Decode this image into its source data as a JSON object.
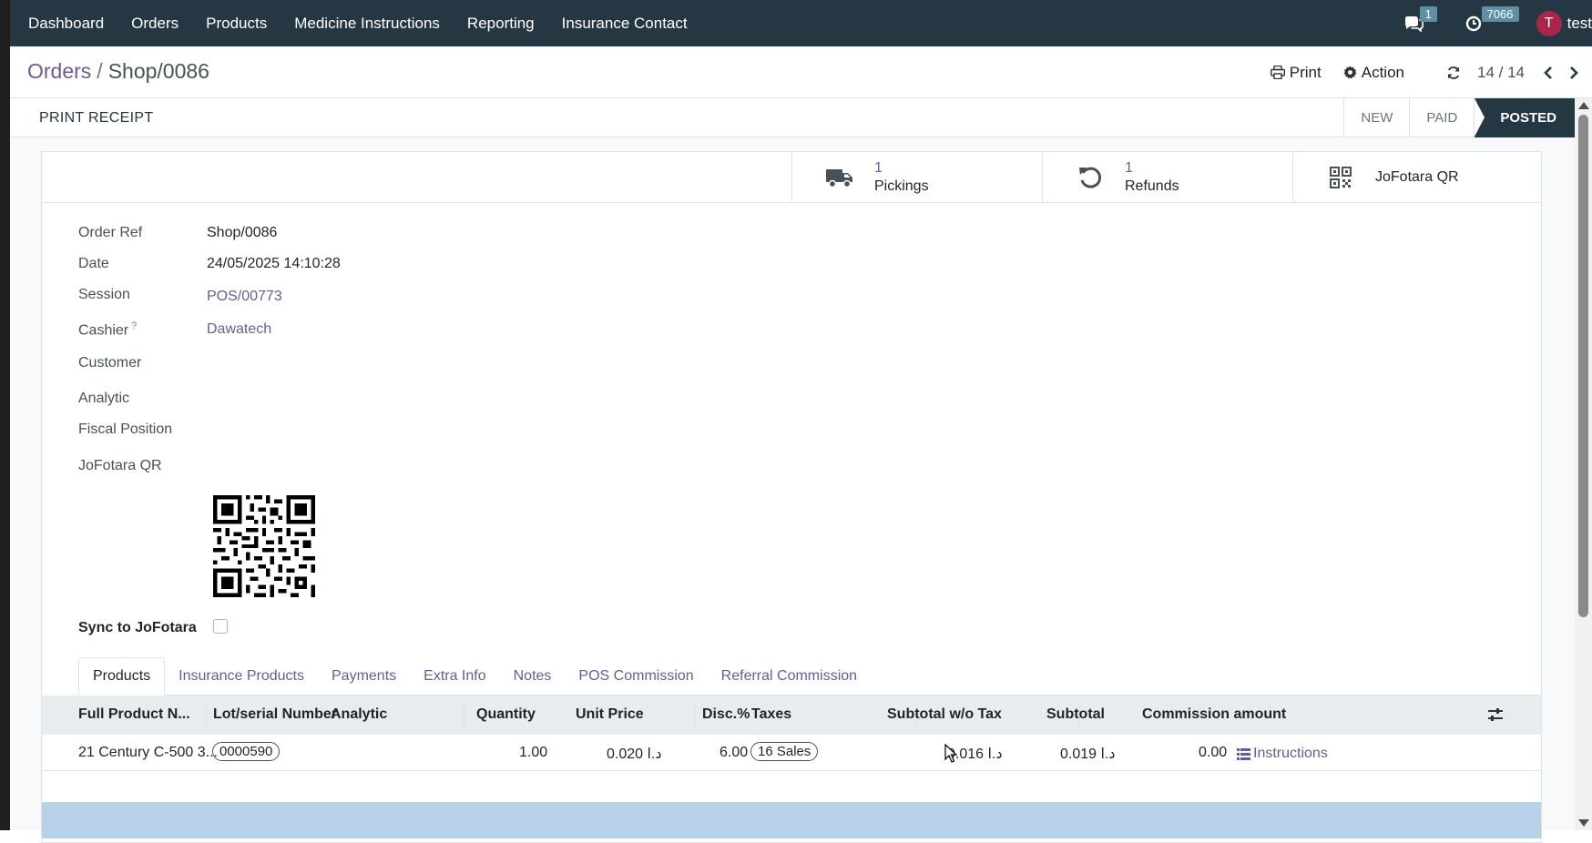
{
  "nav": {
    "items": [
      "Dashboard",
      "Orders",
      "Products",
      "Medicine Instructions",
      "Reporting",
      "Insurance Contact"
    ],
    "messages_count": "1",
    "activities_count": "7066",
    "avatar_letter": "T",
    "username": "test"
  },
  "control": {
    "breadcrumb_parent": "Orders",
    "breadcrumb_sep": "/",
    "breadcrumb_current": "Shop/0086",
    "print_label": "Print",
    "action_label": "Action",
    "pager": "14 / 14"
  },
  "statusrow": {
    "print_receipt": "PRINT RECEIPT",
    "stages": [
      "NEW",
      "PAID",
      "POSTED"
    ],
    "active_stage": "POSTED"
  },
  "smart_buttons": {
    "pickings": {
      "count": "1",
      "label": "Pickings"
    },
    "refunds": {
      "count": "1",
      "label": "Refunds"
    },
    "qr": {
      "label": "JoFotara QR"
    }
  },
  "fields": {
    "order_ref_label": "Order Ref",
    "order_ref": "Shop/0086",
    "date_label": "Date",
    "date": "24/05/2025 14:10:28",
    "session_label": "Session",
    "session": "POS/00773",
    "cashier_label": "Cashier",
    "cashier_help": "?",
    "cashier": "Dawatech",
    "customer_label": "Customer",
    "analytic_label": "Analytic",
    "fiscal_label": "Fiscal Position",
    "qr_label": "JoFotara QR",
    "sync_label": "Sync to JoFotara"
  },
  "tabs": [
    "Products",
    "Insurance Products",
    "Payments",
    "Extra Info",
    "Notes",
    "POS Commission",
    "Referral Commission"
  ],
  "table": {
    "headers": {
      "product": "Full Product N...",
      "lot": "Lot/serial Number",
      "analytic": "Analytic",
      "qty": "Quantity",
      "price": "Unit Price",
      "disc": "Disc.%",
      "taxes": "Taxes",
      "subtotal_wo": "Subtotal w/o Tax",
      "subtotal": "Subtotal",
      "commission": "Commission amount"
    },
    "rows": [
      {
        "product": "21 Century C-500 3...",
        "lot": "0000590",
        "qty": "1.00",
        "price": "0.020  د.ا",
        "disc": "6.00",
        "tax": "16 Sales",
        "subtotal_wo": "0.016  د.ا",
        "subtotal": "0.019  د.ا",
        "commission": "0.00",
        "instructions": "Instructions"
      }
    ]
  },
  "colors": {
    "navbar": "#243742",
    "link": "#6b5b95",
    "active_stage": "#243742",
    "band": "#b7d1e9"
  }
}
